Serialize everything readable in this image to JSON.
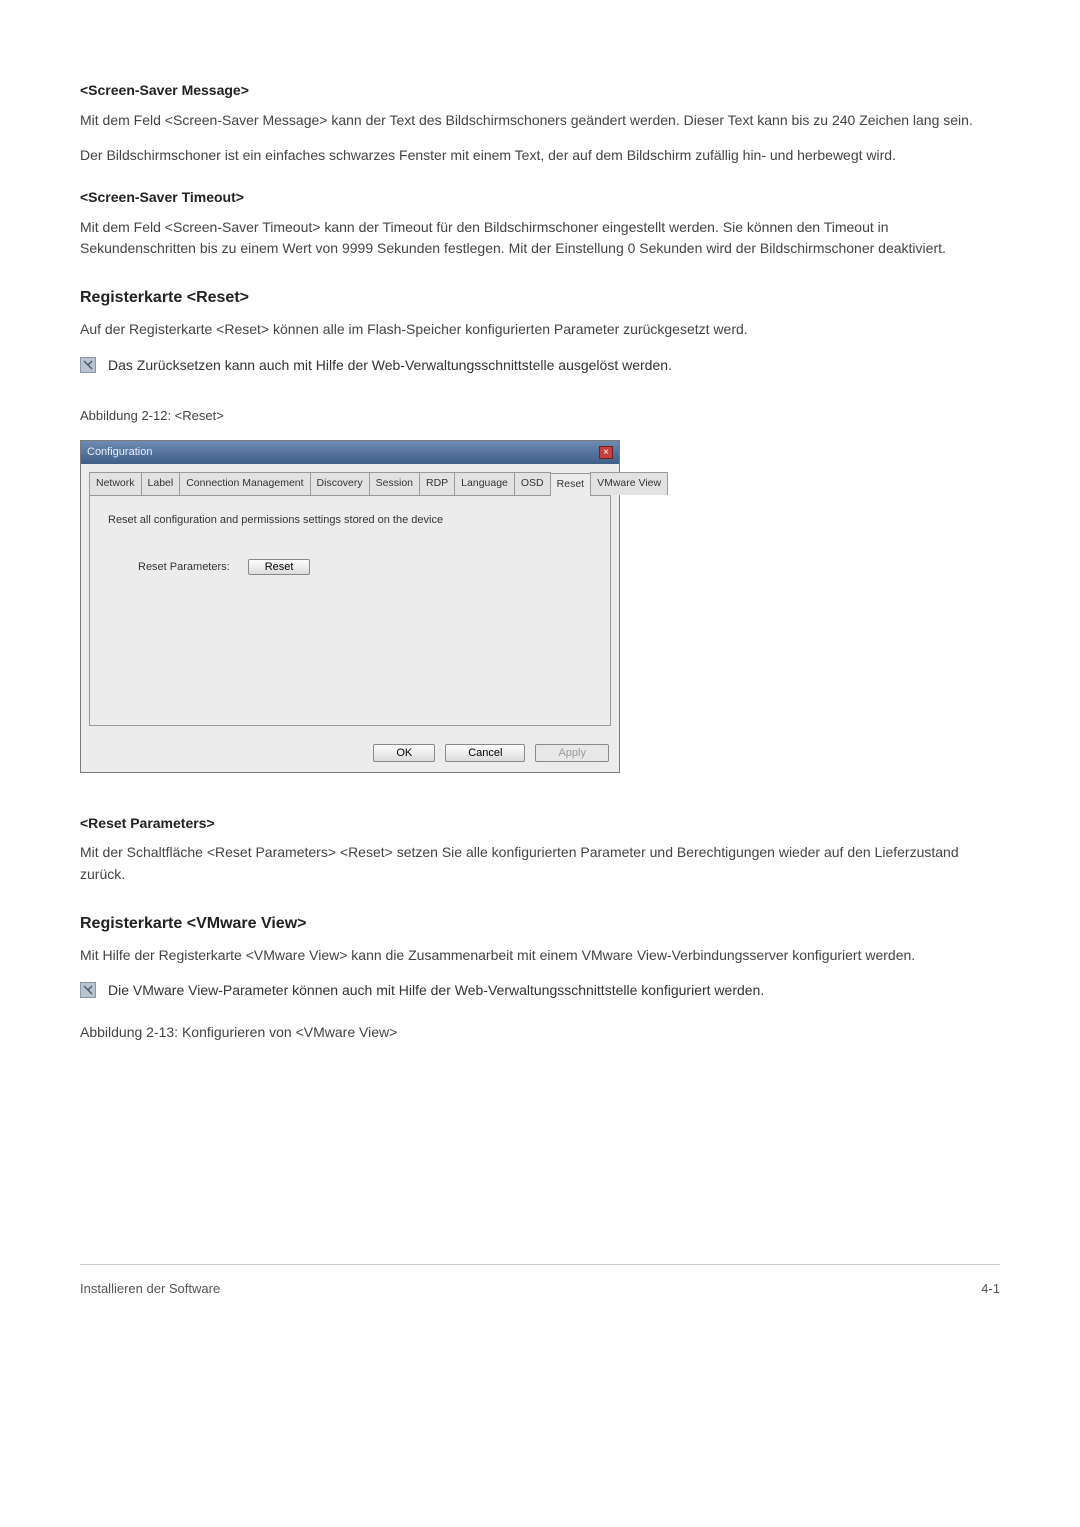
{
  "sections": {
    "screensaver_message": {
      "heading": "<Screen-Saver Message>",
      "p1": "Mit dem Feld <Screen-Saver Message> kann der Text des Bildschirmschoners geändert werden. Dieser Text kann bis zu 240 Zeichen lang sein.",
      "p2": "Der Bildschirmschoner ist ein einfaches schwarzes Fenster mit einem Text, der auf dem Bildschirm zufällig hin- und herbewegt wird."
    },
    "screensaver_timeout": {
      "heading": "<Screen-Saver Timeout>",
      "p1": "Mit dem Feld <Screen-Saver Timeout> kann der Timeout für den Bildschirmschoner eingestellt werden. Sie können den Timeout in Sekundenschritten bis zu einem Wert von 9999 Sekunden festlegen. Mit der Einstellung 0 Sekunden wird der Bildschirmschoner deaktiviert."
    },
    "register_reset": {
      "heading": "Registerkarte <Reset>",
      "p1": "Auf der Registerkarte <Reset> können alle im Flash-Speicher konfigurierten Parameter zurückgesetzt werd.",
      "note": "Das Zurücksetzen kann auch mit Hilfe der Web-Verwaltungsschnittstelle ausgelöst werden.",
      "caption": "Abbildung 2-12: <Reset>"
    },
    "reset_parameters": {
      "heading": "<Reset Parameters>",
      "p1": "Mit der Schaltfläche <Reset Parameters> <Reset> setzen Sie alle konfigurierten Parameter und Berechtigungen wieder auf den Lieferzustand zurück."
    },
    "register_vmware": {
      "heading": "Registerkarte <VMware View>",
      "p1": "Mit Hilfe der Registerkarte <VMware View> kann die Zusammenarbeit mit einem VMware View-Verbindungsserver konfiguriert werden.",
      "note": "Die VMware View-Parameter können auch mit Hilfe der Web-Verwaltungsschnittstelle konfiguriert werden.",
      "caption": "Abbildung 2-13: Konfigurieren von <VMware View>"
    }
  },
  "dialog": {
    "title": "Configuration",
    "close_glyph": "×",
    "tabs": {
      "network": "Network",
      "label": "Label",
      "connmgmt": "Connection Management",
      "discovery": "Discovery",
      "session": "Session",
      "rdp": "RDP",
      "language": "Language",
      "osd": "OSD",
      "reset": "Reset",
      "vmware": "VMware View"
    },
    "panel_desc": "Reset all configuration and permissions settings stored on the device",
    "field_label": "Reset Parameters:",
    "reset_btn": "Reset",
    "buttons": {
      "ok": "OK",
      "cancel": "Cancel",
      "apply": "Apply"
    }
  },
  "footer": {
    "left": "Installieren der Software",
    "right": "4-1"
  }
}
